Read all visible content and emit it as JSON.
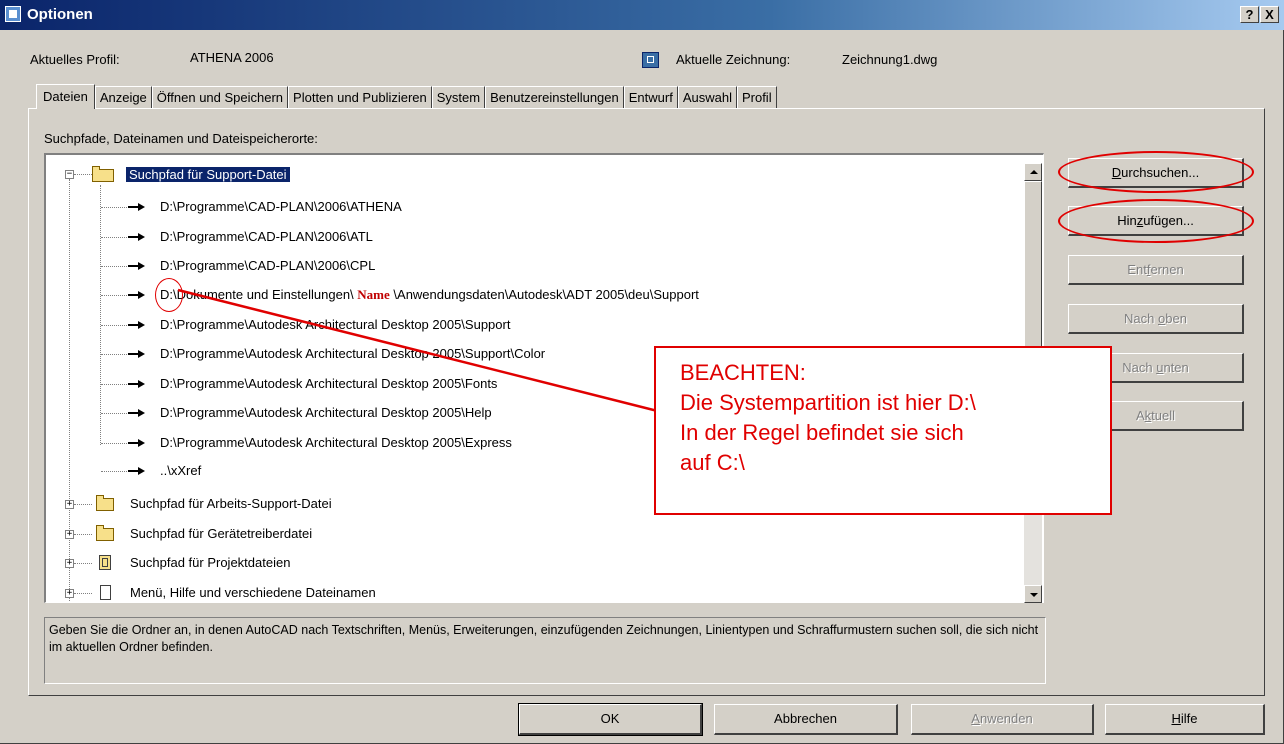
{
  "window": {
    "title": "Optionen",
    "help_button": "?",
    "close_button": "X"
  },
  "profile": {
    "label": "Aktuelles Profil:",
    "value": "ATHENA 2006",
    "drawing_label": "Aktuelle Zeichnung:",
    "drawing_value": "Zeichnung1.dwg"
  },
  "tabs": [
    {
      "label": "Dateien",
      "active": true
    },
    {
      "label": "Anzeige"
    },
    {
      "label": "Öffnen und Speichern"
    },
    {
      "label": "Plotten und Publizieren"
    },
    {
      "label": "System"
    },
    {
      "label": "Benutzereinstellungen"
    },
    {
      "label": "Entwurf"
    },
    {
      "label": "Auswahl"
    },
    {
      "label": "Profil"
    }
  ],
  "main": {
    "section_label": "Suchpfade, Dateinamen und Dateispeicherorte:",
    "tree": {
      "support_node": "Suchpfad für Support-Datei",
      "paths": [
        "D:\\Programme\\CAD-PLAN\\2006\\ATHENA",
        "D:\\Programme\\CAD-PLAN\\2006\\ATL",
        "D:\\Programme\\CAD-PLAN\\2006\\CPL",
        "D:\\Programme\\Autodesk Architectural Desktop 2005\\Support",
        "D:\\Programme\\Autodesk Architectural Desktop 2005\\Support\\Color",
        "D:\\Programme\\Autodesk Architectural Desktop 2005\\Fonts",
        "D:\\Programme\\Autodesk Architectural Desktop 2005\\Help",
        "D:\\Programme\\Autodesk Architectural Desktop 2005\\Express",
        "..\\xXref"
      ],
      "user_path": {
        "prefix": "D:\\Dokumente und Einstellungen\\ ",
        "name": "Name",
        "suffix": " \\Anwendungsdaten\\Autodesk\\ADT 2005\\deu\\Support"
      },
      "other_nodes": [
        "Suchpfad für Arbeits-Support-Datei",
        "Suchpfad für Gerätetreiberdatei",
        "Suchpfad für Projektdateien",
        "Menü, Hilfe und verschiedene Dateinamen"
      ]
    },
    "description": "Geben Sie die Ordner an, in denen AutoCAD nach Textschriften, Menüs, Erweiterungen, einzufügenden  Zeichnungen, Linientypen und Schraffurmustern suchen soll, die sich nicht im aktuellen Ordner befinden."
  },
  "side_buttons": {
    "browse": {
      "pre": "",
      "key": "D",
      "post": "urchsuchen..."
    },
    "add": {
      "pre": "Hin",
      "key": "z",
      "post": "ufügen..."
    },
    "remove": {
      "pre": "Ent",
      "key": "f",
      "post": "ernen"
    },
    "up": {
      "pre": "Nach ",
      "key": "o",
      "post": "ben"
    },
    "down": {
      "pre": "Nach ",
      "key": "u",
      "post": "nten"
    },
    "current": {
      "pre": "A",
      "key": "k",
      "post": "tuell"
    }
  },
  "footer": {
    "ok": "OK",
    "cancel": "Abbrechen",
    "apply": {
      "pre": "",
      "key": "A",
      "post": "nwenden"
    },
    "help": {
      "pre": "",
      "key": "H",
      "post": "ilfe"
    }
  },
  "annotation": {
    "lines": [
      "BEACHTEN:",
      "Die Systempartition ist hier D:\\",
      "In der Regel befindet sie sich",
      "auf C:\\"
    ],
    "color": "#e00000"
  },
  "colors": {
    "selection": "#0a246a",
    "titlebar": "#0a246a",
    "annotation": "#e00000",
    "dialog": "#d4d0c8"
  }
}
